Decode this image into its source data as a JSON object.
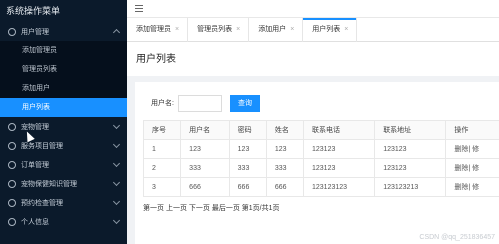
{
  "app": {
    "title": "系统操作菜单"
  },
  "sidebar": {
    "groups": [
      {
        "label": "用户管理",
        "expanded": true,
        "items": [
          {
            "label": "添加管理员"
          },
          {
            "label": "管理员列表"
          },
          {
            "label": "添加用户"
          },
          {
            "label": "用户列表",
            "active": true
          }
        ]
      },
      {
        "label": "宠物管理"
      },
      {
        "label": "服务项目管理"
      },
      {
        "label": "订单管理"
      },
      {
        "label": "宠物保健知识管理"
      },
      {
        "label": "预约检查管理"
      },
      {
        "label": "个人信息"
      }
    ]
  },
  "tabs": [
    {
      "label": "添加管理员",
      "close": "×"
    },
    {
      "label": "管理员列表",
      "close": "×"
    },
    {
      "label": "添加用户",
      "close": "×"
    },
    {
      "label": "用户列表",
      "close": "×",
      "active": true
    }
  ],
  "page": {
    "title": "用户列表"
  },
  "search": {
    "label": "用户名:",
    "button": "查询",
    "value": ""
  },
  "table": {
    "headers": [
      "序号",
      "用户名",
      "密码",
      "姓名",
      "联系电话",
      "联系地址",
      "操作"
    ],
    "rows": [
      [
        "1",
        "123",
        "123",
        "123",
        "123123",
        "123123",
        "删除| 修"
      ],
      [
        "2",
        "333",
        "333",
        "333",
        "123123",
        "123123",
        "删除| 修"
      ],
      [
        "3",
        "666",
        "666",
        "666",
        "123123123",
        "123123213",
        "删除| 修"
      ]
    ]
  },
  "pager": {
    "text": "第一页 上一页 下一页 最后一页 第1页/共1页"
  },
  "watermark": "CSDN @qq_251836457",
  "colors": {
    "sidebar_bg": "#0b1a2b",
    "accent": "#1890ff"
  }
}
